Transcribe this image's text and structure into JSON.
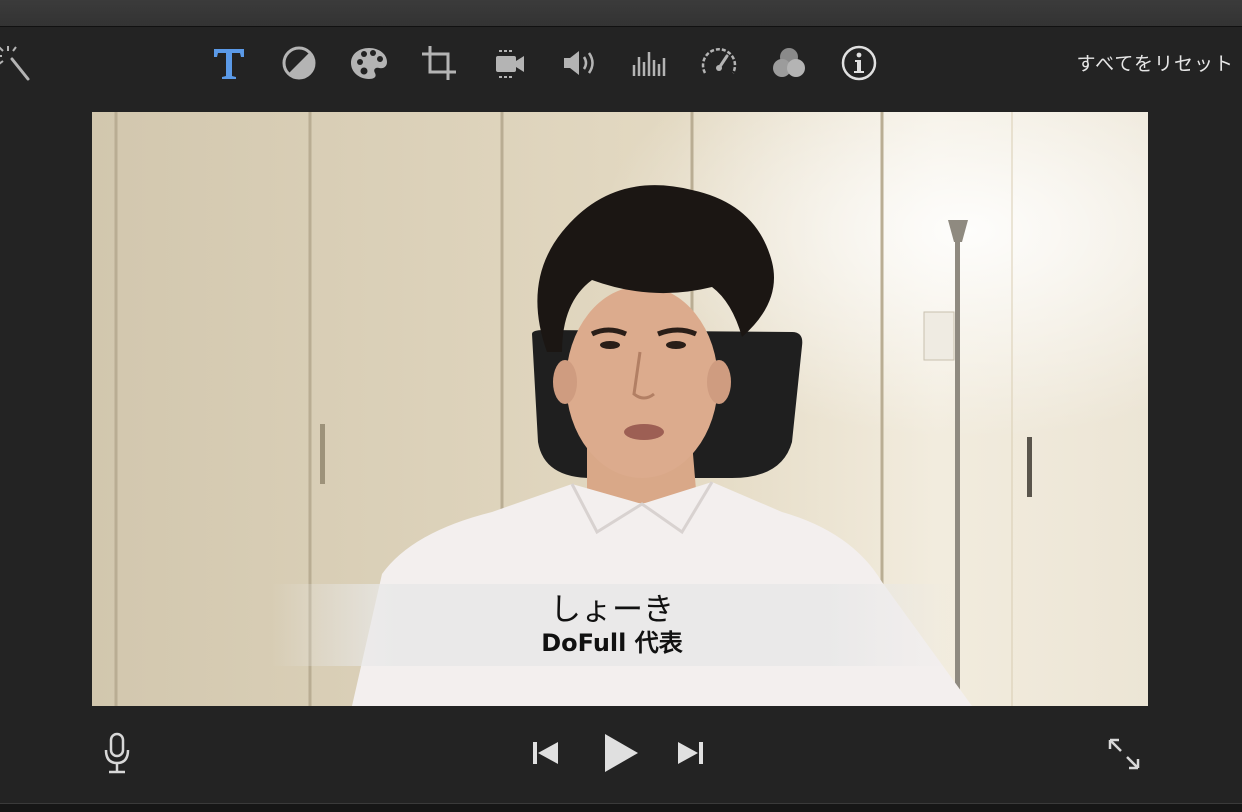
{
  "toolbar": {
    "reset_label": "すべてをリセット",
    "tools": [
      {
        "icon": "magic-wand-icon"
      },
      {
        "icon": "title-text-icon",
        "active": true
      },
      {
        "icon": "color-balance-icon"
      },
      {
        "icon": "color-palette-icon"
      },
      {
        "icon": "crop-icon"
      },
      {
        "icon": "stabilization-camera-icon"
      },
      {
        "icon": "volume-icon"
      },
      {
        "icon": "noise-equalizer-icon"
      },
      {
        "icon": "speed-gauge-icon"
      },
      {
        "icon": "clip-filter-icon"
      },
      {
        "icon": "info-icon"
      }
    ],
    "accent_color": "#5b9ae8",
    "icon_color": "#b4b4b4"
  },
  "viewer": {
    "caption_name": "しょーき",
    "caption_role": "DoFull 代表"
  },
  "controls": {
    "voiceover": "microphone-icon",
    "previous": "skip-back-icon",
    "play": "play-icon",
    "next": "skip-forward-icon",
    "fullscreen": "fullscreen-icon"
  }
}
